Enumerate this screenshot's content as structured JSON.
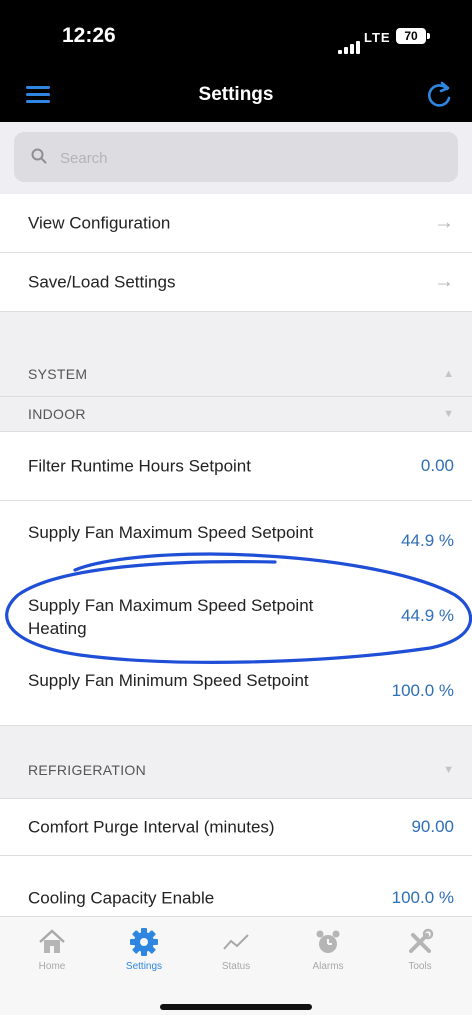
{
  "status_bar": {
    "time": "12:26",
    "network": "LTE",
    "battery": "70"
  },
  "nav": {
    "title": "Settings",
    "menu_icon": "hamburger-menu-icon",
    "refresh_icon": "refresh-icon"
  },
  "search": {
    "placeholder": "Search",
    "value": ""
  },
  "links": [
    {
      "label": "View Configuration"
    },
    {
      "label": "Save/Load Settings"
    }
  ],
  "sections": {
    "system": {
      "label": "SYSTEM",
      "state": "expanded"
    },
    "indoor": {
      "label": "INDOOR",
      "state": "collapsed"
    },
    "refrigeration": {
      "label": "REFRIGERATION",
      "state": "collapsed"
    }
  },
  "indoor_settings": [
    {
      "label": "Filter Runtime Hours Setpoint",
      "value": "0.00"
    },
    {
      "label": "Supply Fan Maximum Speed Setpoint",
      "value": "44.9 %"
    },
    {
      "label": "Supply Fan Maximum Speed Setpoint Heating",
      "value": "44.9 %"
    },
    {
      "label": "Supply Fan Minimum Speed Setpoint",
      "value": "100.0 %"
    }
  ],
  "refrigeration_settings": [
    {
      "label": "Comfort Purge Interval (minutes)",
      "value": "90.00"
    },
    {
      "label": "Cooling Capacity Enable",
      "value": "100.0 %"
    }
  ],
  "annotation": {
    "color": "#1f4fd6"
  },
  "tabs": [
    {
      "label": "Home",
      "icon": "home-icon",
      "active": false
    },
    {
      "label": "Settings",
      "icon": "gear-icon",
      "active": true
    },
    {
      "label": "Status",
      "icon": "status-graph-icon",
      "active": false
    },
    {
      "label": "Alarms",
      "icon": "alarm-clock-icon",
      "active": false
    },
    {
      "label": "Tools",
      "icon": "tools-icon",
      "active": false
    }
  ],
  "colors": {
    "accent": "#2f86e0",
    "value_text": "#2f6fb5",
    "header_bg": "#000000"
  }
}
